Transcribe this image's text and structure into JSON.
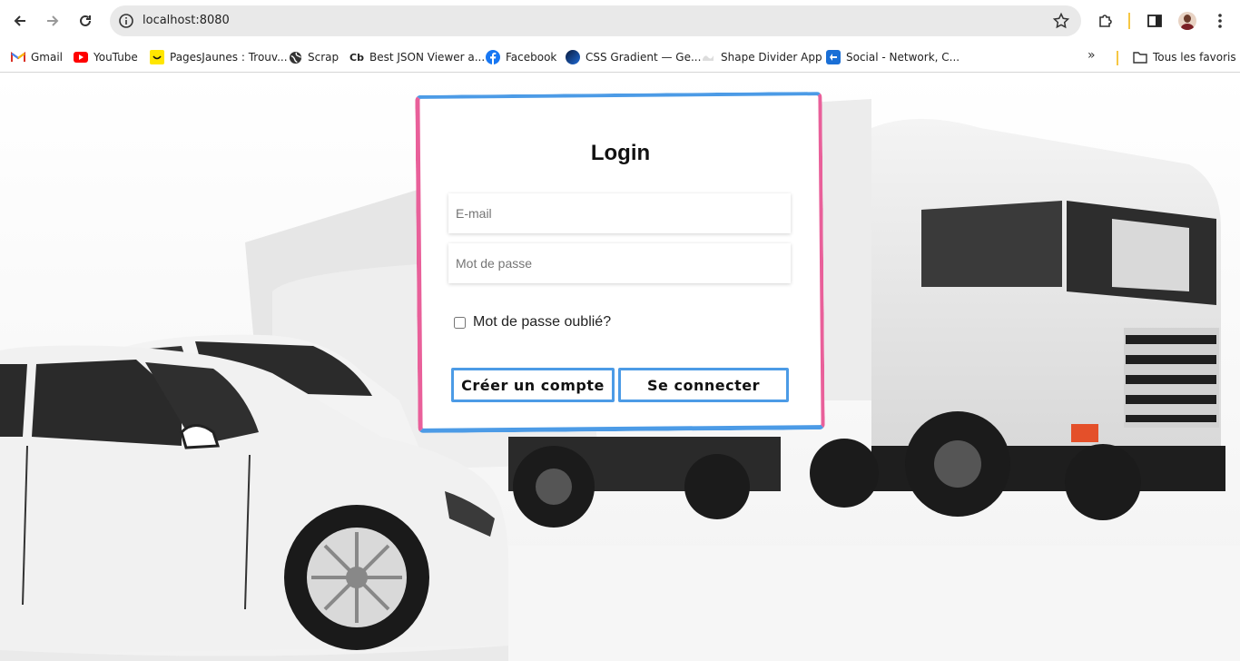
{
  "browser": {
    "url": "localhost:8080",
    "bookmarks": [
      {
        "label": "Gmail",
        "icon": "gmail-icon"
      },
      {
        "label": "YouTube",
        "icon": "youtube-icon"
      },
      {
        "label": "PagesJaunes : Trouv...",
        "icon": "pagesjaunes-icon"
      },
      {
        "label": "Scrap",
        "icon": "globe-icon"
      },
      {
        "label": "Best JSON Viewer a...",
        "icon": "cb-icon"
      },
      {
        "label": "Facebook",
        "icon": "facebook-icon"
      },
      {
        "label": "CSS Gradient — Ge...",
        "icon": "css-gradient-icon"
      },
      {
        "label": "Shape Divider App",
        "icon": "shape-divider-icon"
      },
      {
        "label": "Social - Network, C...",
        "icon": "social-icon"
      }
    ],
    "more_label": "»",
    "all_bookmarks_label": "Tous les favoris"
  },
  "login": {
    "title": "Login",
    "email_placeholder": "E-mail",
    "password_placeholder": "Mot de passe",
    "forgot_label": "Mot de passe oublié?",
    "create_account_label": "Créer un compte",
    "login_label": "Se connecter"
  },
  "colors": {
    "accent_blue": "#4c9be6",
    "accent_pink": "#e9609a"
  }
}
